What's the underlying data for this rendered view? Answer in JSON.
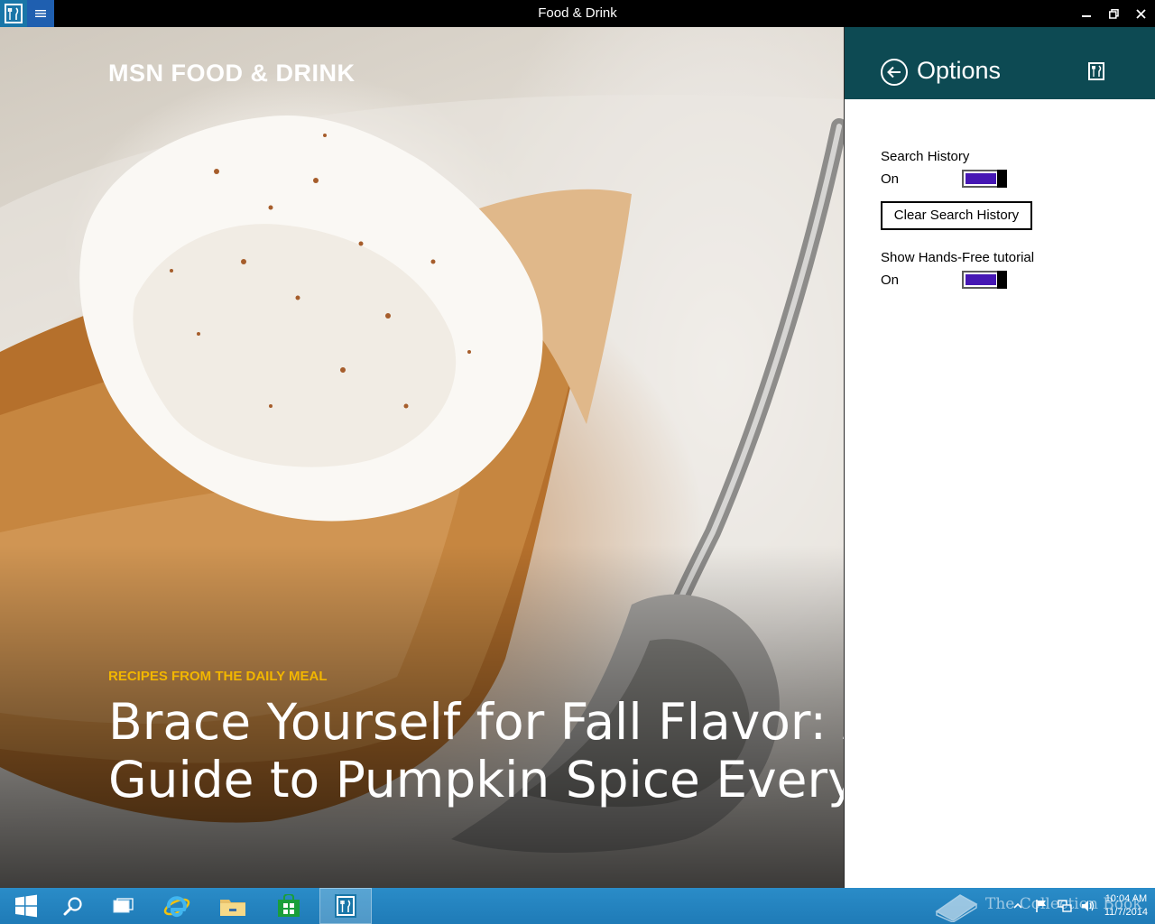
{
  "window": {
    "title": "Food & Drink",
    "app_icon": "food-drink-app-icon",
    "menu_icon": "hamburger-menu-icon",
    "controls": [
      "minimize-icon",
      "restore-icon",
      "close-icon"
    ]
  },
  "hero": {
    "brand": "MSN FOOD & DRINK",
    "kicker": "RECIPES FROM THE DAILY MEAL",
    "headline_line1": "Brace Yourself for Fall Flavor: A",
    "headline_line2": "Guide to Pumpkin Spice Everythin"
  },
  "options": {
    "title": "Options",
    "back_icon": "back-arrow-icon",
    "logo_icon": "fork-knife-icon",
    "search_history": {
      "label": "Search History",
      "state": "On"
    },
    "clear_button": "Clear Search History",
    "hands_free": {
      "label": "Show Hands-Free tutorial",
      "state": "On"
    },
    "toggle_color": "#4617b4"
  },
  "taskbar": {
    "items": [
      {
        "name": "start-button",
        "icon": "windows-logo-icon"
      },
      {
        "name": "search-button",
        "icon": "search-icon"
      },
      {
        "name": "task-view-button",
        "icon": "task-view-icon"
      },
      {
        "name": "internet-explorer-button",
        "icon": "internet-explorer-icon"
      },
      {
        "name": "file-explorer-button",
        "icon": "folder-icon"
      },
      {
        "name": "store-button",
        "icon": "store-icon"
      },
      {
        "name": "food-drink-taskbar-button",
        "icon": "food-drink-app-icon"
      }
    ],
    "tray": [
      "show-hidden-icons",
      "flag-icon",
      "network-icon",
      "volume-icon"
    ],
    "time": "10:04 AM",
    "date": "11/7/2014",
    "watermark": "The Collection Book"
  }
}
